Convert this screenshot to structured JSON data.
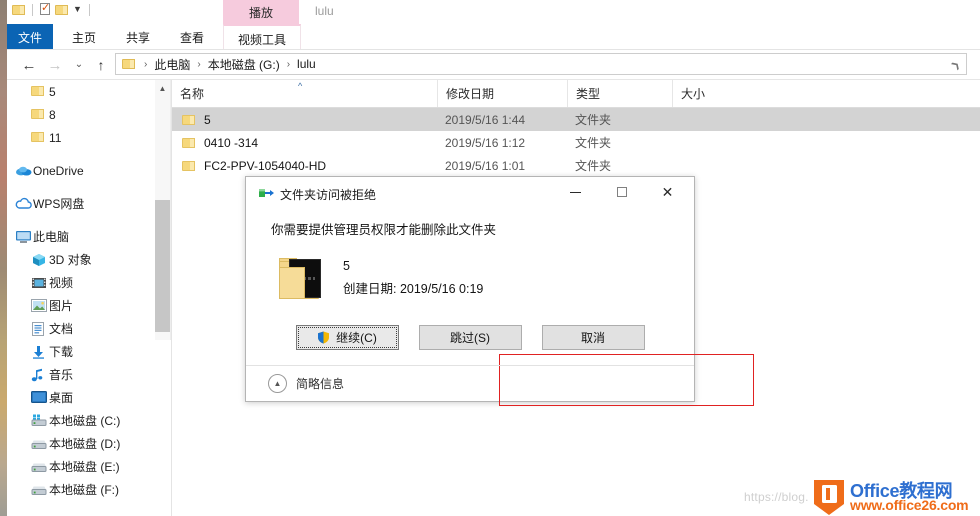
{
  "window": {
    "title": "lulu",
    "quick_access": [
      "folder-icon",
      "properties-icon",
      "new-folder-icon",
      "customize-caret-icon"
    ]
  },
  "ribbon": {
    "contextual_group_label": "播放",
    "tabs": [
      {
        "label": "文件",
        "name": "tab-file"
      },
      {
        "label": "主页",
        "name": "tab-home"
      },
      {
        "label": "共享",
        "name": "tab-share"
      },
      {
        "label": "查看",
        "name": "tab-view"
      },
      {
        "label": "视频工具",
        "name": "tab-video-tools"
      }
    ]
  },
  "address_bar": {
    "back_icon": "←",
    "forward_icon": "→",
    "recent_icon": "⌄",
    "up_icon": "↑",
    "separator": "›",
    "crumbs": [
      "此电脑",
      "本地磁盘 (G:)",
      "lulu"
    ]
  },
  "nav_pane": {
    "items": [
      {
        "label": "5",
        "icon": "folder-icon",
        "indent": true
      },
      {
        "label": "8",
        "icon": "folder-icon",
        "indent": true
      },
      {
        "label": "11",
        "icon": "folder-icon",
        "indent": true
      },
      {
        "label": "OneDrive",
        "icon": "onedrive-icon",
        "indent": false
      },
      {
        "label": "WPS网盘",
        "icon": "wps-cloud-icon",
        "indent": false
      },
      {
        "label": "此电脑",
        "icon": "this-pc-icon",
        "indent": false
      },
      {
        "label": "3D 对象",
        "icon": "3d-objects-icon",
        "indent": true
      },
      {
        "label": "视频",
        "icon": "videos-icon",
        "indent": true
      },
      {
        "label": "图片",
        "icon": "pictures-icon",
        "indent": true
      },
      {
        "label": "文档",
        "icon": "documents-icon",
        "indent": true
      },
      {
        "label": "下载",
        "icon": "downloads-icon",
        "indent": true
      },
      {
        "label": "音乐",
        "icon": "music-icon",
        "indent": true
      },
      {
        "label": "桌面",
        "icon": "desktop-icon",
        "indent": true
      },
      {
        "label": "本地磁盘 (C:)",
        "icon": "system-drive-icon",
        "indent": true
      },
      {
        "label": "本地磁盘 (D:)",
        "icon": "drive-icon",
        "indent": true
      },
      {
        "label": "本地磁盘 (E:)",
        "icon": "drive-icon",
        "indent": true
      },
      {
        "label": "本地磁盘 (F:)",
        "icon": "drive-icon",
        "indent": true
      }
    ]
  },
  "file_list": {
    "columns": [
      {
        "label": "名称",
        "sorted": true
      },
      {
        "label": "修改日期",
        "sorted": false
      },
      {
        "label": "类型",
        "sorted": false
      },
      {
        "label": "大小",
        "sorted": false
      }
    ],
    "sort_indicator": "^",
    "rows": [
      {
        "name": "5",
        "date": "2019/5/16 1:44",
        "type": "文件夹",
        "size": "",
        "selected": true
      },
      {
        "name": "0410 -314",
        "date": "2019/5/16 1:12",
        "type": "文件夹",
        "size": "",
        "selected": false
      },
      {
        "name": "FC2-PPV-1054040-HD",
        "date": "2019/5/16 1:01",
        "type": "文件夹",
        "size": "",
        "selected": false
      }
    ]
  },
  "dialog": {
    "title": "文件夹访问被拒绝",
    "icon": "folder-move-icon",
    "message": "你需要提供管理员权限才能删除此文件夹",
    "item_name": "5",
    "item_date": "创建日期: 2019/5/16 0:19",
    "item_icon": "folder-thumbnail-icon",
    "buttons": [
      {
        "label": "继续(C)",
        "name": "continue-button",
        "shield": true,
        "focused": true
      },
      {
        "label": "跳过(S)",
        "name": "skip-button",
        "shield": false,
        "focused": false
      },
      {
        "label": "取消",
        "name": "cancel-button",
        "shield": false,
        "focused": false
      }
    ],
    "footer_label": "简略信息",
    "footer_icon": "chevron-up-icon",
    "minimize_label": "—",
    "maximize_label": "□",
    "close_label": "✕",
    "highlight_color": "#e02222"
  },
  "watermark": {
    "url_faint": "https://blog.",
    "brand_cn": "Office教程网",
    "brand_url": "www.office26.com",
    "brand_color": "#ef6c19",
    "brand_cn_color": "#2e6fd0"
  },
  "colors": {
    "accent": "#0b64b4",
    "contextual_tab": "#f6cbdd",
    "selection": "#d3d3d3"
  }
}
